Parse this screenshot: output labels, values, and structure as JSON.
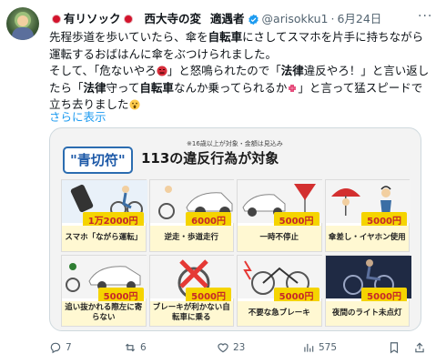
{
  "tweet": {
    "author_display_name": "有リソック",
    "author_name_part2": "西大寺の変",
    "author_name_part3": "適遇者",
    "handle": "@arisokku1",
    "date_separator": "·",
    "date": "6月24日",
    "more_label": "···",
    "text": {
      "line1": "先程歩道を歩いていたら、傘を",
      "bold1": "自転車",
      "line1b": "にさしてスマホを片手に持ちながら運転するおばはんに傘をぶつけられました。",
      "line2a": "そして、「危ないやろ",
      "line2b": "」と怒鳴られたので「",
      "bold2": "法律",
      "line2c": "違反やろ！」と言い返したら「",
      "bold3": "法律",
      "line2d": "守って",
      "bold4": "自転車",
      "line2e": "なんか乗ってられるか",
      "line2f": "」と言って猛スピードで立ち去りました"
    },
    "show_more": "さらに表示"
  },
  "card": {
    "badge": "\"青切符\"",
    "headline": "113の違反行為が対象",
    "note": "※16歳以上が対象・金額は見込み",
    "items": [
      {
        "fine": "1万2000円",
        "label": "スマホ「ながら運転」"
      },
      {
        "fine": "6000円",
        "label": "逆走・歩道走行"
      },
      {
        "fine": "5000円",
        "label": "一時不停止"
      },
      {
        "fine": "5000円",
        "label": "傘差し・イヤホン使用"
      },
      {
        "fine": "5000円",
        "label": "追い抜かれる際左に寄らない"
      },
      {
        "fine": "5000円",
        "label": "ブレーキが利かない自転車に乗る"
      },
      {
        "fine": "5000円",
        "label": "不要な急ブレーキ"
      },
      {
        "fine": "5000円",
        "label": "夜間のライト未点灯"
      }
    ]
  },
  "actions": {
    "replies": "7",
    "retweets": "6",
    "likes": "23",
    "views": "575"
  },
  "colors": {
    "accent": "#1d9bf0",
    "fine_bg": "#f5d400",
    "fine_text": "#c62828"
  }
}
